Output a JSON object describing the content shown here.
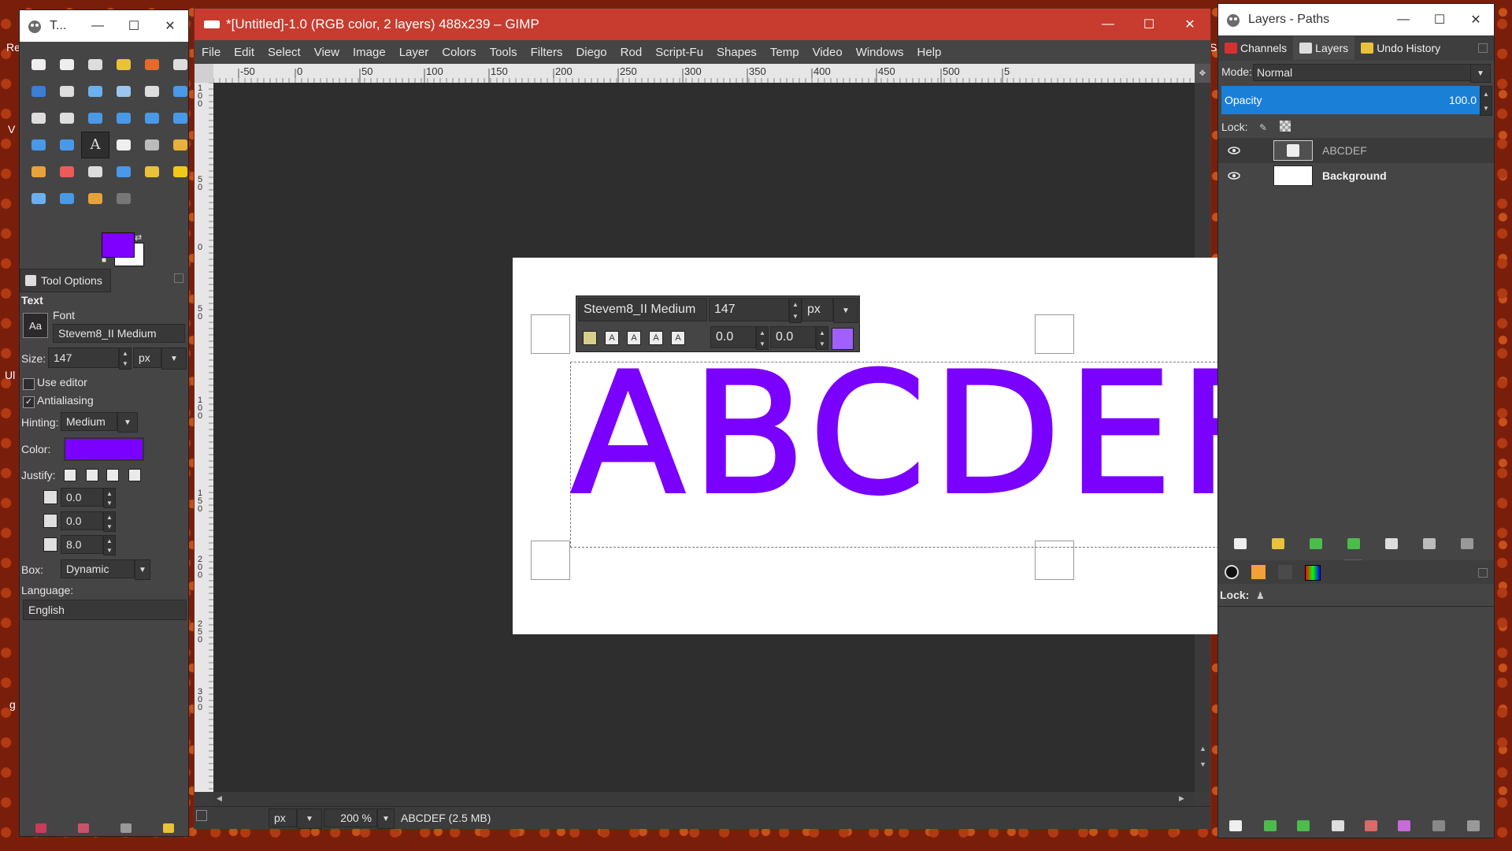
{
  "desktop": {
    "left_labels": [
      "Re",
      "Ul",
      "V",
      "g"
    ],
    "right_label": "Sh"
  },
  "toolbox": {
    "title": "T...",
    "tools": [
      {
        "icon": "rect-select-icon",
        "color": "#eeeeee"
      },
      {
        "icon": "ellipse-select-icon",
        "color": "#eeeeee"
      },
      {
        "icon": "free-select-icon",
        "color": "#dddddd"
      },
      {
        "icon": "fuzzy-select-icon",
        "color": "#e8c23a"
      },
      {
        "icon": "select-by-color-icon",
        "color": "#e06b2a"
      },
      {
        "icon": "scissors-select-icon",
        "color": "#dddddd"
      },
      {
        "icon": "foreground-select-icon",
        "color": "#3a7ed6"
      },
      {
        "icon": "paths-icon",
        "color": "#dddddd"
      },
      {
        "icon": "color-picker-icon",
        "color": "#6ab0f0"
      },
      {
        "icon": "zoom-icon",
        "color": "#9ac6f0"
      },
      {
        "icon": "measure-icon",
        "color": "#dddddd"
      },
      {
        "icon": "move-icon",
        "color": "#4a98e8"
      },
      {
        "icon": "align-icon",
        "color": "#dddddd"
      },
      {
        "icon": "crop-icon",
        "color": "#dddddd"
      },
      {
        "icon": "rotate-icon",
        "color": "#4a98e8"
      },
      {
        "icon": "scale-icon",
        "color": "#4a98e8"
      },
      {
        "icon": "shear-icon",
        "color": "#4a98e8"
      },
      {
        "icon": "perspective-icon",
        "color": "#4a98e8"
      },
      {
        "icon": "flip-icon",
        "color": "#4a98e8"
      },
      {
        "icon": "cage-icon",
        "color": "#4a98e8"
      },
      {
        "icon": "text-tool-icon",
        "color": "#dddddd",
        "active": true
      },
      {
        "icon": "bucket-fill-icon",
        "color": "#eeeeee"
      },
      {
        "icon": "blend-icon",
        "color": "#bbbbbb"
      },
      {
        "icon": "pencil-icon",
        "color": "#e8b23a"
      },
      {
        "icon": "paintbrush-icon",
        "color": "#e8a23a"
      },
      {
        "icon": "eraser-icon",
        "color": "#ee5a5a"
      },
      {
        "icon": "airbrush-icon",
        "color": "#dddddd"
      },
      {
        "icon": "ink-icon",
        "color": "#4a98e8"
      },
      {
        "icon": "clone-icon",
        "color": "#e8c23a"
      },
      {
        "icon": "heal-icon",
        "color": "#f0c81a"
      },
      {
        "icon": "perspective-clone-icon",
        "color": "#6ab0f0"
      },
      {
        "icon": "blur-icon",
        "color": "#4a98e8"
      },
      {
        "icon": "smudge-icon",
        "color": "#e8a23a"
      },
      {
        "icon": "dodge-burn-icon",
        "color": "#777777"
      }
    ],
    "fg_color": "#8000ff",
    "bg_color": "#ffffff",
    "tab_label": "Tool Options",
    "options": {
      "section": "Text",
      "font_label": "Font",
      "font_value": "Stevem8_II Medium",
      "size_label": "Size:",
      "size_value": "147",
      "size_unit": "px",
      "use_editor": "Use editor",
      "use_editor_checked": false,
      "antialiasing": "Antialiasing",
      "antialiasing_checked": true,
      "hinting_label": "Hinting:",
      "hinting_value": "Medium",
      "color_label": "Color:",
      "color_value": "#7a00ff",
      "justify_label": "Justify:",
      "indent_value": "0.0",
      "line_spacing_value": "0.0",
      "letter_spacing_value": "8.0",
      "box_label": "Box:",
      "box_value": "Dynamic",
      "language_label": "Language:",
      "language_value": "English"
    }
  },
  "main": {
    "title": "*[Untitled]-1.0 (RGB color, 2 layers) 488x239 – GIMP",
    "menu": [
      "File",
      "Edit",
      "Select",
      "View",
      "Image",
      "Layer",
      "Colors",
      "Tools",
      "Filters",
      "Diego",
      "Rod",
      "Script-Fu",
      "Shapes",
      "Temp",
      "Video",
      "Windows",
      "Help"
    ],
    "hruler_labels": [
      "-50",
      "0",
      "50",
      "100",
      "150",
      "200",
      "250",
      "300",
      "350",
      "400",
      "450",
      "500",
      "5"
    ],
    "vruler_labels": [
      "1\n0\n0",
      "5\n0",
      "0",
      "5\n0",
      "1\n0\n0",
      "1\n5\n0",
      "2\n0\n0",
      "2\n5\n0",
      "3\n0\n0"
    ],
    "canvas_text": "ABCDEF",
    "text_color": "#7a00ff",
    "onscreen_toolbar": {
      "font": "Stevem8_II Medium",
      "size": "147",
      "unit": "px",
      "baseline": "0.0",
      "kerning": "0.0",
      "color": "#a060ff"
    },
    "status": {
      "unit": "px",
      "zoom": "200 %",
      "info": "ABCDEF (2.5 MB)"
    }
  },
  "layers_dock": {
    "title": "Layers - Paths",
    "tabs": [
      "Channels",
      "Layers",
      "Undo History"
    ],
    "mode_label": "Mode:",
    "mode_value": "Normal",
    "opacity_label": "Opacity",
    "opacity_value": "100.0",
    "lock_label": "Lock:",
    "layers": [
      {
        "name": "ABCDEF",
        "type": "text",
        "selected": true
      },
      {
        "name": "Background",
        "type": "image",
        "selected": false
      }
    ],
    "lower_lock_label": "Lock:"
  }
}
